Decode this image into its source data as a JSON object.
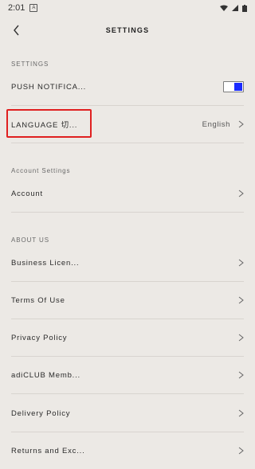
{
  "status_bar": {
    "time": "2:01"
  },
  "header": {
    "title": "SETTINGS"
  },
  "sections": {
    "settings": "SETTINGS",
    "account": "Account Settings",
    "about": "ABOUT US"
  },
  "rows": {
    "push": {
      "label": "PUSH NOTIFICA..."
    },
    "language": {
      "label": "LANGUAGE 切...",
      "value": "English"
    },
    "account": {
      "label": "Account"
    },
    "business": {
      "label": "Business Licen..."
    },
    "terms": {
      "label": "Terms Of Use"
    },
    "privacy": {
      "label": "Privacy Policy"
    },
    "adiclub": {
      "label": "adiCLUB Memb..."
    },
    "delivery": {
      "label": "Delivery Policy"
    },
    "returns": {
      "label": "Returns and Exc..."
    }
  },
  "colors": {
    "accent": "#1b2bff",
    "highlight": "#e02020",
    "background": "#ece9e5"
  }
}
